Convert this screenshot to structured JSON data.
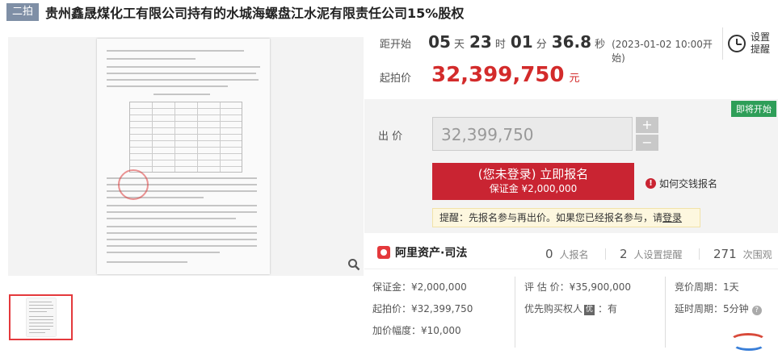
{
  "title": {
    "tag": "二拍",
    "text": "贵州鑫晟煤化工有限公司持有的水城海螺盘江水泥有限责任公司15%股权"
  },
  "countdown": {
    "label": "距开始",
    "days": "05",
    "days_unit": "天",
    "hours": "23",
    "hours_unit": "时",
    "minutes": "01",
    "minutes_unit": "分",
    "seconds": "36.8",
    "seconds_unit": "秒",
    "start_text": "(2023-01-02 10:00开始)"
  },
  "remind": {
    "label": "设置提醒",
    "icon": "alarm-clock-icon"
  },
  "starting_price": {
    "label": "起拍价",
    "value": "32,399,750",
    "unit": "元"
  },
  "bid": {
    "badge": "即将开始",
    "label": "出 价",
    "value": "32,399,750",
    "plus": "+",
    "minus": "−",
    "apply_main": "(您未登录) 立即报名",
    "apply_sub": "保证金 ¥2,000,000",
    "help_icon": "!",
    "help_text": "如何交钱报名",
    "tip_text": "提醒：先报名参与再出价。如果您已经报名参与，请",
    "tip_link": "登录"
  },
  "stats": {
    "brand": "阿里资产·司法",
    "signups": "0",
    "signups_label": "人报名",
    "reminders": "2",
    "reminders_label": "人设置提醒",
    "views": "271",
    "views_label": "次围观"
  },
  "info": {
    "deposit": "保证金：¥2,000,000",
    "starting": "起拍价：¥32,399,750",
    "increment": "加价幅度：¥10,000",
    "appraisal": "评 估 价：¥35,900,000",
    "priority_label": "优先购买权人",
    "priority_badge": "优",
    "priority_value": "：有",
    "cycle": "竞价周期：1天",
    "extension": "延时周期：5分钟"
  },
  "colors": {
    "accent_red": "#d32b2b",
    "button_red": "#c92432",
    "badge_green": "#2e9e58",
    "tag_gray": "#7f8fa6"
  }
}
